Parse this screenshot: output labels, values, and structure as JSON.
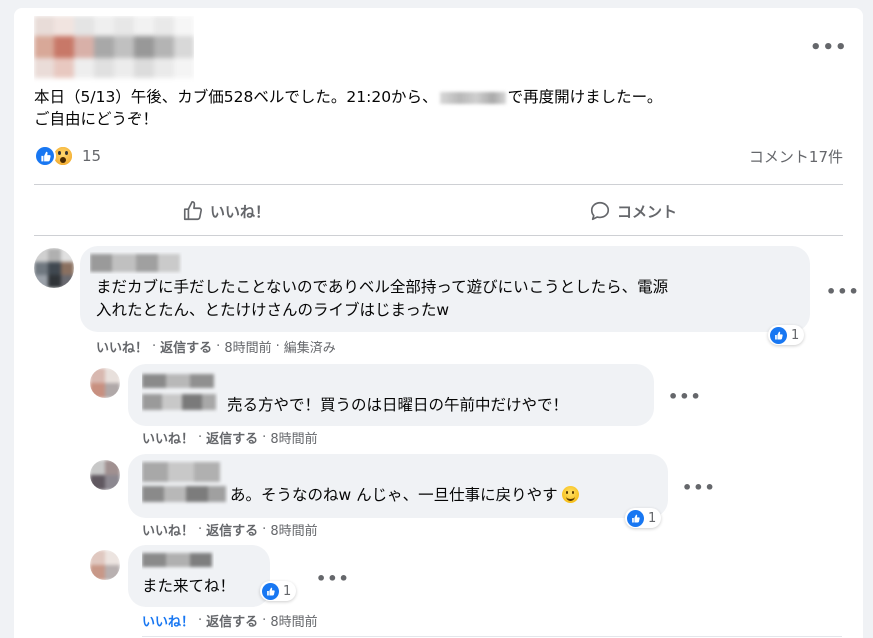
{
  "post": {
    "text_line1_a": "本日（5/13）午後、カブ価528ベルでした。21:20から、",
    "text_line1_b": "で再度開けましたー。",
    "text_line2": "ご自由にどうぞ！",
    "more_label": "•••"
  },
  "reactions": {
    "count": "15"
  },
  "comments_count": "コメント17件",
  "actions": {
    "like": "いいね！",
    "comment": "コメント"
  },
  "comments": [
    {
      "text_line1": "まだカブに手だしたことないのでありベル全部持って遊びにいこうとしたら、電源",
      "text_line2": "入れたとたん、とたけけさんのライブはじまったw",
      "like": "いいね！",
      "reply": "返信する",
      "time": "8時間前",
      "edited": "編集済み",
      "reaction_count": "1"
    },
    {
      "text": "売る方やで！買うのは日曜日の午前中だけやで！",
      "like": "いいね！",
      "reply": "返信する",
      "time": "8時間前"
    },
    {
      "text": "あ。そうなのねw んじゃ、一旦仕事に戻りやす",
      "like": "いいね！",
      "reply": "返信する",
      "time": "8時間前",
      "reaction_count": "1"
    },
    {
      "text": "また来てね！",
      "like": "いいね！",
      "reply": "返信する",
      "time": "8時間前",
      "reaction_count": "1"
    }
  ],
  "colors": {
    "accent": "#1877f2",
    "secondary_text": "#65676b",
    "bubble": "#f0f2f5"
  }
}
